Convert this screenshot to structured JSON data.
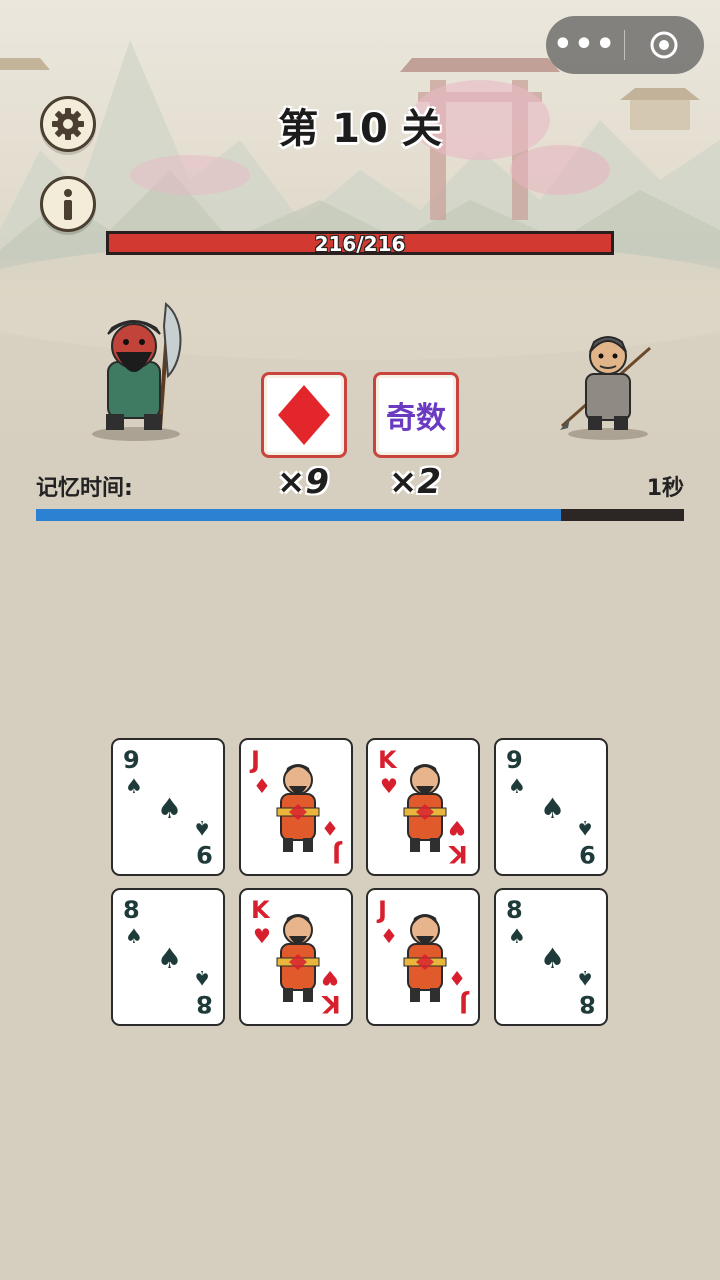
{
  "level": {
    "title": "第 10 关"
  },
  "capsule": {
    "more_label": "•••"
  },
  "boss": {
    "hp_text": "216/216",
    "hp_fraction": 1.0
  },
  "clues": [
    {
      "type": "suit",
      "suit": "♦",
      "color": "#e3262c",
      "count_label": "×9"
    },
    {
      "type": "text",
      "label": "奇数",
      "color": "#6a3ac1",
      "count_label": "×2"
    }
  ],
  "memory": {
    "label": "记忆时间:",
    "seconds_label": "1秒",
    "remaining_fraction": 0.81
  },
  "cards": [
    {
      "rank": "9",
      "suit": "♠",
      "color": "black",
      "court": false
    },
    {
      "rank": "J",
      "suit": "♦",
      "color": "red",
      "court": true
    },
    {
      "rank": "K",
      "suit": "♥",
      "color": "red",
      "court": true
    },
    {
      "rank": "9",
      "suit": "♠",
      "color": "black",
      "court": false
    },
    {
      "rank": "8",
      "suit": "♠",
      "color": "black",
      "court": false
    },
    {
      "rank": "K",
      "suit": "♥",
      "color": "red",
      "court": true
    },
    {
      "rank": "J",
      "suit": "♦",
      "color": "red",
      "court": true
    },
    {
      "rank": "8",
      "suit": "♠",
      "color": "black",
      "court": false
    }
  ],
  "icons": [
    "gear-icon",
    "info-icon",
    "more-icon",
    "target-icon"
  ]
}
